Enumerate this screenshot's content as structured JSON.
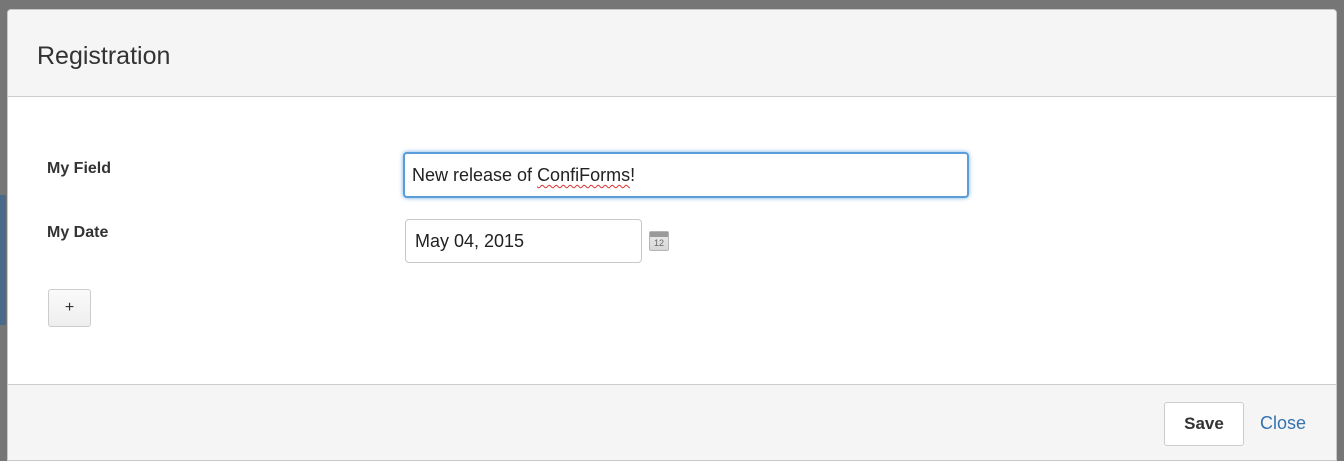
{
  "dialog": {
    "title": "Registration"
  },
  "form": {
    "my_field": {
      "label": "My Field",
      "value_prefix": "New release of ",
      "value_misspelled": "ConfiForms",
      "value_suffix": "!"
    },
    "my_date": {
      "label": "My Date",
      "value": "May 04, 2015"
    },
    "calendar_icon_day": "12",
    "add_button_label": "+"
  },
  "footer": {
    "save_label": "Save",
    "close_label": "Close"
  },
  "colors": {
    "focus_border": "#5b9dd9",
    "link": "#3572b0",
    "spellcheck_underline": "#d93030"
  }
}
